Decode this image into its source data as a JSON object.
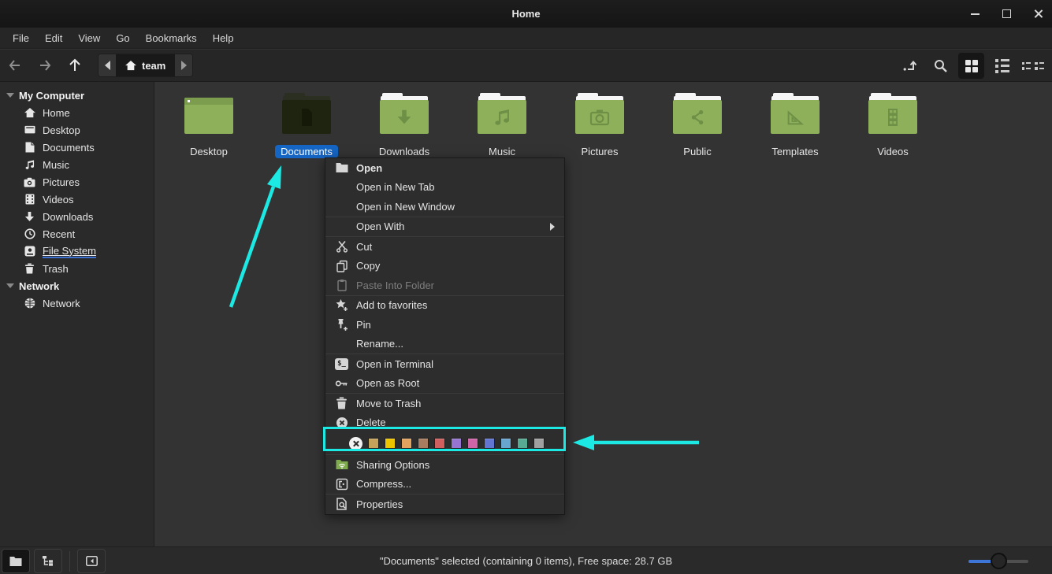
{
  "window": {
    "title": "Home"
  },
  "menubar": {
    "items": [
      {
        "label": "File"
      },
      {
        "label": "Edit"
      },
      {
        "label": "View"
      },
      {
        "label": "Go"
      },
      {
        "label": "Bookmarks"
      },
      {
        "label": "Help"
      }
    ]
  },
  "toolbar": {
    "breadcrumb_label": "team"
  },
  "sidebar": {
    "sections": [
      {
        "label": "My Computer",
        "items": [
          {
            "label": "Home"
          },
          {
            "label": "Desktop"
          },
          {
            "label": "Documents"
          },
          {
            "label": "Music"
          },
          {
            "label": "Pictures"
          },
          {
            "label": "Videos"
          },
          {
            "label": "Downloads"
          },
          {
            "label": "Recent"
          },
          {
            "label": "File System"
          },
          {
            "label": "Trash"
          }
        ]
      },
      {
        "label": "Network",
        "items": [
          {
            "label": "Network"
          }
        ]
      }
    ]
  },
  "files": {
    "folders": [
      {
        "label": "Desktop"
      },
      {
        "label": "Documents",
        "selected": true
      },
      {
        "label": "Downloads"
      },
      {
        "label": "Music"
      },
      {
        "label": "Pictures"
      },
      {
        "label": "Public"
      },
      {
        "label": "Templates"
      },
      {
        "label": "Videos"
      }
    ]
  },
  "context_menu": {
    "items": [
      {
        "label": "Open"
      },
      {
        "label": "Open in New Tab"
      },
      {
        "label": "Open in New Window"
      },
      {
        "label": "Open With"
      },
      {
        "label": "Cut"
      },
      {
        "label": "Copy"
      },
      {
        "label": "Paste Into Folder",
        "disabled": true
      },
      {
        "label": "Add to favorites"
      },
      {
        "label": "Pin"
      },
      {
        "label": "Rename..."
      },
      {
        "label": "Open in Terminal"
      },
      {
        "label": "Open as Root"
      },
      {
        "label": "Move to Trash"
      },
      {
        "label": "Delete"
      },
      {
        "label": "Sharing Options"
      },
      {
        "label": "Compress..."
      },
      {
        "label": "Properties"
      }
    ],
    "colors": [
      "#c4a259",
      "#ecc500",
      "#e2a35f",
      "#a87c5e",
      "#d05f5f",
      "#9674d2",
      "#cf64a8",
      "#6175d1",
      "#68a6d0",
      "#59aa92",
      "#a0a0a0"
    ]
  },
  "statusbar": {
    "text": "\"Documents\" selected (containing 0 items), Free space: 28.7 GB"
  },
  "icons": {
    "terminal_glyph": "$_"
  },
  "theme": {
    "accent_blue": "#1565c4",
    "folder_green": "#8fb05a",
    "annotation_cyan": "#1de9e4",
    "slider_blue": "#3d76d6"
  }
}
